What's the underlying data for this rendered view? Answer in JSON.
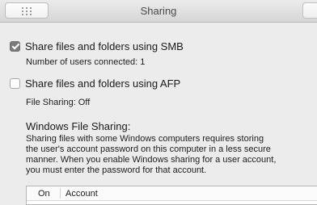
{
  "window": {
    "title": "Sharing"
  },
  "icons": {
    "grid": "grid-icon"
  },
  "smb": {
    "label": "Share files and folders using SMB",
    "checked": true,
    "status": "Number of users connected: 1"
  },
  "afp": {
    "label": "Share files and folders using AFP",
    "checked": false,
    "status": "File Sharing: Off"
  },
  "windows_sharing": {
    "heading": "Windows File Sharing:",
    "description_lines": [
      "Sharing files with some Windows computers requires storing",
      "the user's account password on this computer in a less secure",
      "manner.  When you enable Windows sharing for a user account,",
      "you must enter the password for that account."
    ]
  },
  "accounts_table": {
    "columns": [
      "On",
      "Account"
    ]
  }
}
